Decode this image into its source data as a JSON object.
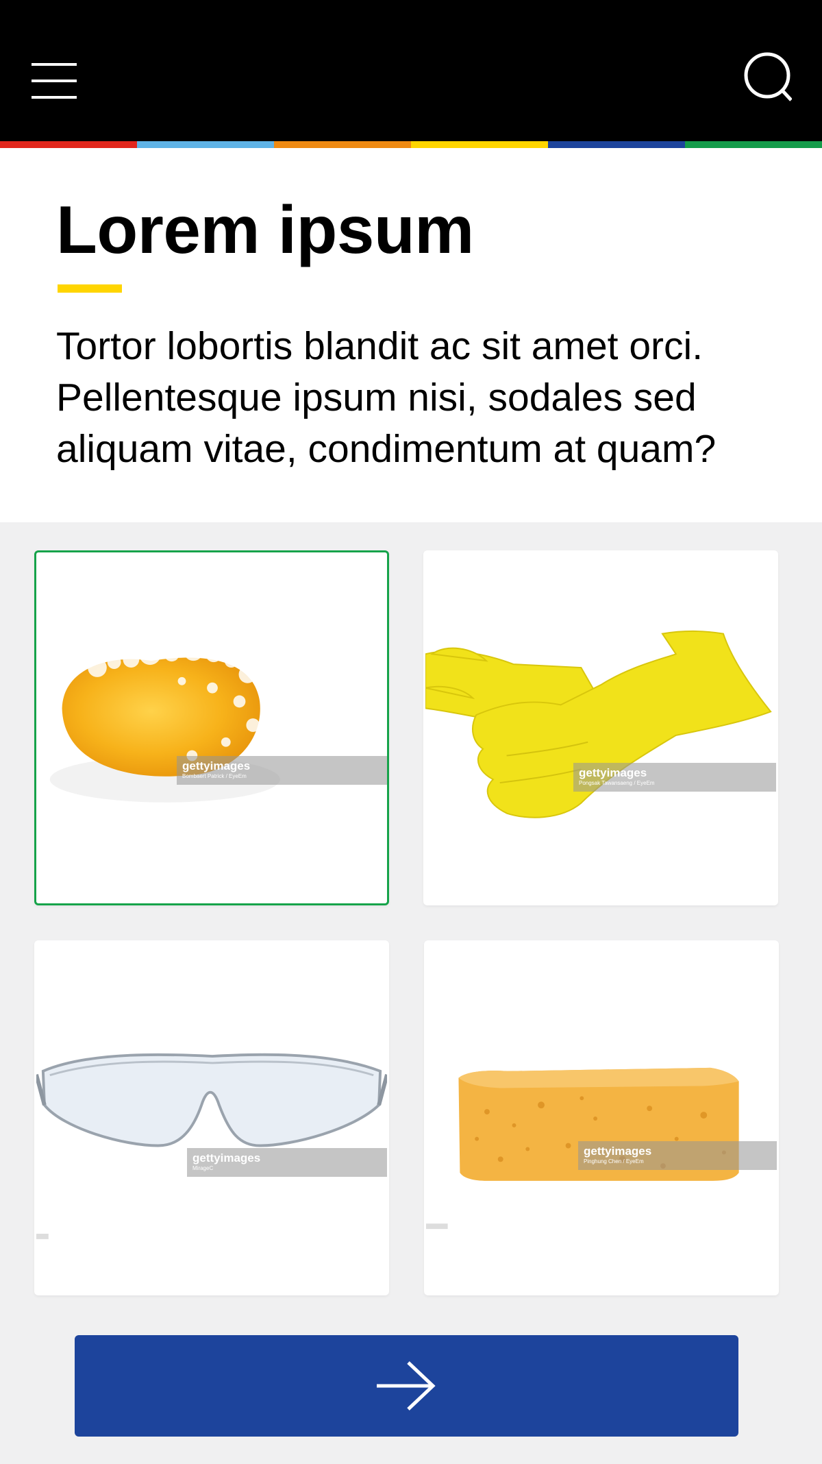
{
  "header": {
    "menu_icon": "hamburger-menu-icon",
    "search_icon": "search-icon",
    "stripe_colors": [
      "#e2261c",
      "#5fb3e6",
      "#ef8a12",
      "#ffd500",
      "#1d449c",
      "#149c4a"
    ]
  },
  "intro": {
    "title": "Lorem ipsum",
    "underline_color": "#ffd500",
    "description": "Tortor lobortis blandit ac sit amet orci. Pellentesque ipsum nisi, sodales sed aliquam vitae, condimentum at quam?"
  },
  "options": [
    {
      "image": "soap-bar-with-foam",
      "selected": true,
      "watermark": {
        "brand": "gettyimages",
        "credit": "Bombaert Patrick / EyeEm"
      }
    },
    {
      "image": "yellow-rubber-gloves",
      "selected": false,
      "watermark": {
        "brand": "gettyimages",
        "credit": "Pongsak Tawansaeng / EyeEm"
      }
    },
    {
      "image": "safety-goggles",
      "selected": false,
      "watermark": {
        "brand": "gettyimages",
        "credit": "MirageC"
      }
    },
    {
      "image": "yellow-sponge",
      "selected": false,
      "watermark": {
        "brand": "gettyimages",
        "credit": "Pinghung Chen / EyeEm"
      }
    }
  ],
  "selection_color": "#16a34a",
  "next_button": {
    "icon": "arrow-right-icon",
    "color": "#1d449c"
  }
}
